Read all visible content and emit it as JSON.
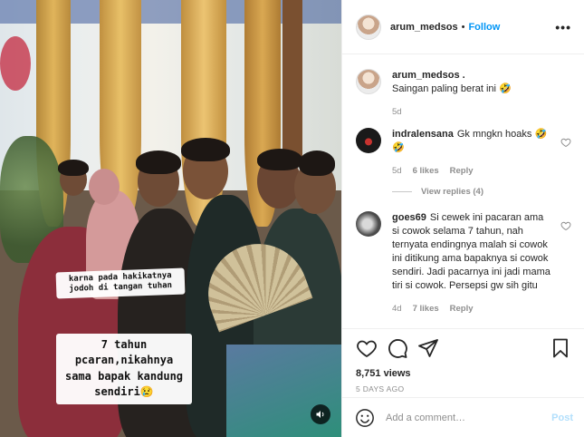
{
  "post": {
    "username": "arum_medsos",
    "separator": "•",
    "follow_label": "Follow",
    "more_label": "•••"
  },
  "video": {
    "caption_top": "karna pada hakikatnya jodoh di tangan tuhan",
    "caption_main": "7 tahun pcaran,nikahnya sama bapak kandung sendiri😢",
    "sound_icon": "speaker-icon"
  },
  "comments": [
    {
      "username": "arum_medsos .",
      "text": "Saingan paling berat ini 🤣",
      "time": "5d"
    },
    {
      "username": "indralensana",
      "text": "Gk mngkn hoaks 🤣🤣",
      "time": "5d",
      "likes": "6 likes",
      "reply": "Reply",
      "view_replies": "View replies (4)"
    },
    {
      "username": "goes69",
      "text": "Si cewek ini pacaran ama si cowok selama 7 tahun, nah ternyata endingnya malah si cowok ini ditikung ama bapaknya si cowok sendiri. Jadi pacarnya ini jadi mama tiri si cowok. Persepsi gw sih gitu",
      "time": "4d",
      "likes": "7 likes",
      "reply": "Reply"
    }
  ],
  "actions": {
    "views": "8,751 views",
    "time_ago": "5 DAYS AGO"
  },
  "composer": {
    "placeholder": "Add a comment…",
    "post_label": "Post"
  },
  "colors": {
    "accent": "#0095f6",
    "post_disabled": "#b2dffc",
    "muted": "#8e8e8e"
  }
}
